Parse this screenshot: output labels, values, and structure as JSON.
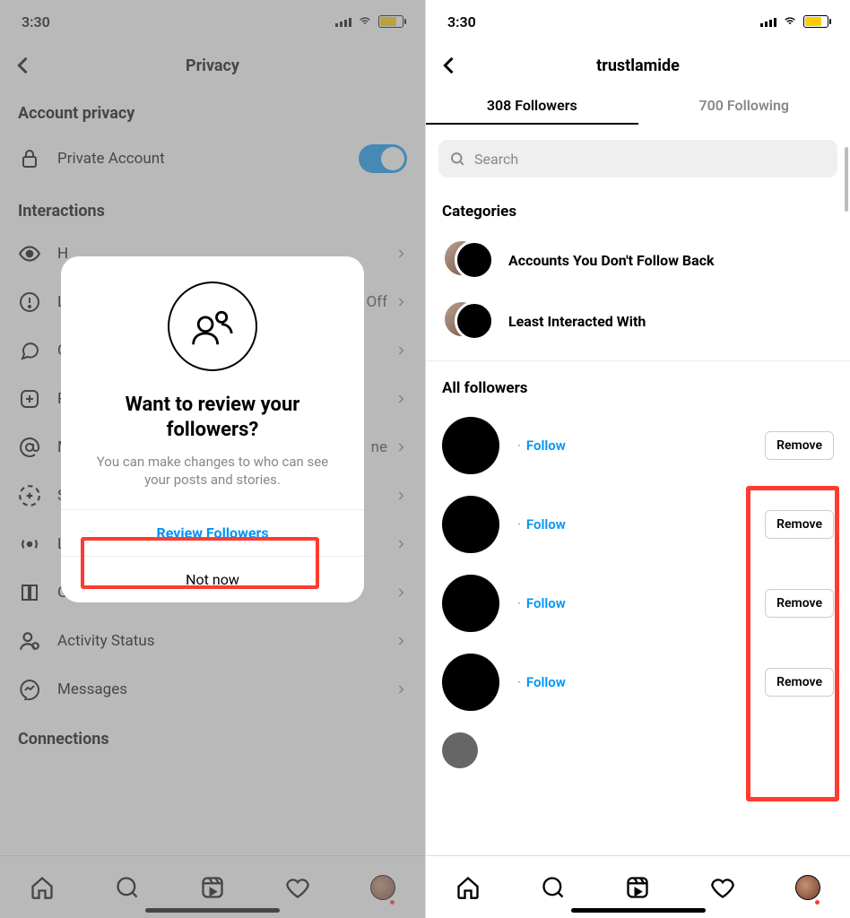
{
  "status": {
    "time": "3:30"
  },
  "left": {
    "title": "Privacy",
    "section_account": "Account privacy",
    "private_account": "Private Account",
    "section_interactions": "Interactions",
    "rows": [
      {
        "label": "H",
        "value": ""
      },
      {
        "label": "L",
        "value": "Off"
      },
      {
        "label": "C",
        "value": ""
      },
      {
        "label": "P",
        "value": ""
      },
      {
        "label": "M",
        "value": "ne"
      },
      {
        "label": "S",
        "value": ""
      },
      {
        "label": "L",
        "value": ""
      },
      {
        "label": "G",
        "value": ""
      },
      {
        "label": "Activity Status",
        "value": ""
      },
      {
        "label": "Messages",
        "value": ""
      }
    ],
    "section_connections": "Connections",
    "modal": {
      "title": "Want to review your followers?",
      "body": "You can make changes to who can see your posts and stories.",
      "primary": "Review Followers",
      "secondary": "Not now"
    }
  },
  "right": {
    "username": "trustlamide",
    "followers_tab": "308 Followers",
    "following_tab": "700 Following",
    "search_placeholder": "Search",
    "categories_title": "Categories",
    "categories": [
      {
        "label": "Accounts You Don't Follow Back"
      },
      {
        "label": "Least Interacted With"
      }
    ],
    "all_followers_title": "All followers",
    "follow_label": "Follow",
    "remove_label": "Remove"
  }
}
